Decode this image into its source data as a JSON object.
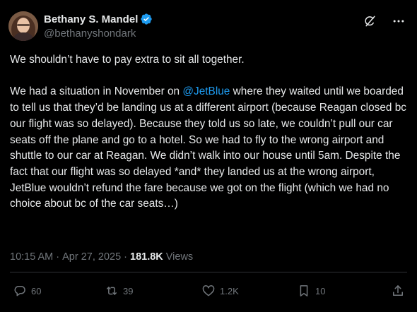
{
  "author": {
    "display_name": "Bethany S. Mandel",
    "handle": "@bethanyshondark",
    "verified": true
  },
  "body": {
    "paragraph1": "We shouldn’t have to pay extra to sit all together.",
    "p2_before": "We had a situation in November on ",
    "mention": "@JetBlue",
    "p2_after": " where they waited until we boarded to tell us that they’d be landing us at a different airport (because Reagan closed bc our flight was so delayed). Because they told us so late, we couldn’t pull our car seats off the plane and go to a hotel. So we had to fly to the wrong airport and shuttle to our car at Reagan. We didn’t walk into our house until 5am. Despite the fact that our flight was so delayed *and* they landed us at the wrong airport, JetBlue wouldn’t refund the fare because we got on the flight (which we had no choice about bc of the car seats…)"
  },
  "meta": {
    "time": "10:15 AM",
    "separator": "·",
    "date": "Apr 27, 2025",
    "views_count": "181.8K",
    "views_label": "Views"
  },
  "actions": {
    "replies": "60",
    "reposts": "39",
    "likes": "1.2K",
    "bookmarks": "10"
  },
  "icons": [
    "verified-badge-icon",
    "grok-icon",
    "more-icon",
    "reply-icon",
    "repost-icon",
    "like-icon",
    "bookmark-icon",
    "share-icon"
  ],
  "colors": {
    "background": "#000000",
    "text": "#e7e9ea",
    "muted": "#71767b",
    "accent": "#1d9bf0"
  }
}
